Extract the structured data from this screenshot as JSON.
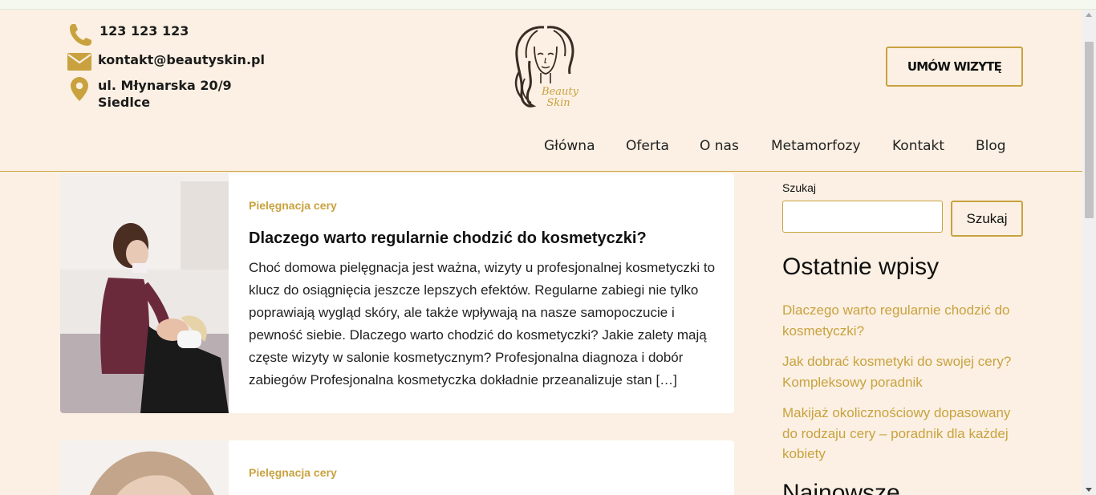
{
  "contact": {
    "phone": "123 123 123",
    "email": "kontakt@beautyskin.pl",
    "address_line1": "ul. Młynarska 20/9",
    "address_line2": "Siedlce"
  },
  "logo": {
    "text_line1": "Beauty",
    "text_line2": "Skin"
  },
  "cta": {
    "label": "UMÓW WIZYTĘ"
  },
  "nav": {
    "items": [
      {
        "label": "Główna"
      },
      {
        "label": "Oferta"
      },
      {
        "label": "O nas"
      },
      {
        "label": "Metamorfozy"
      },
      {
        "label": "Kontakt"
      },
      {
        "label": "Blog"
      }
    ]
  },
  "posts": [
    {
      "category": "Pielęgnacja cery",
      "title": "Dlaczego warto regularnie chodzić do kosmetyczki?",
      "excerpt": "Choć domowa pielęgnacja jest ważna, wizyty u profesjonalnej kosmetyczki to klucz do osiągnięcia jeszcze lepszych efektów. Regularne zabiegi nie tylko poprawiają wygląd skóry, ale także wpływają na nasze samopoczucie i pewność siebie. Dlaczego warto chodzić do kosmetyczki? Jakie zalety mają częste wizyty w salonie kosmetycznym? Profesjonalna diagnoza i dobór zabiegów Profesjonalna kosmetyczka dokładnie przeanalizuje stan […]"
    },
    {
      "category": "Pielęgnacja cery"
    }
  ],
  "sidebar": {
    "search_label": "Szukaj",
    "search_value": "",
    "search_button": "Szukaj",
    "recent_heading": "Ostatnie wpisy",
    "recent": [
      "Dlaczego warto regularnie chodzić do kosmetyczki?",
      "Jak dobrać kosmetyki do swojej cery? Kompleksowy poradnik",
      "Makijaż okolicznościowy dopasowany do rodzaju cery – poradnik dla każdej kobiety"
    ],
    "next_heading": "Najnowsze"
  },
  "colors": {
    "accent": "#c9a23f",
    "background": "#fbf0e3",
    "text": "#111111"
  }
}
